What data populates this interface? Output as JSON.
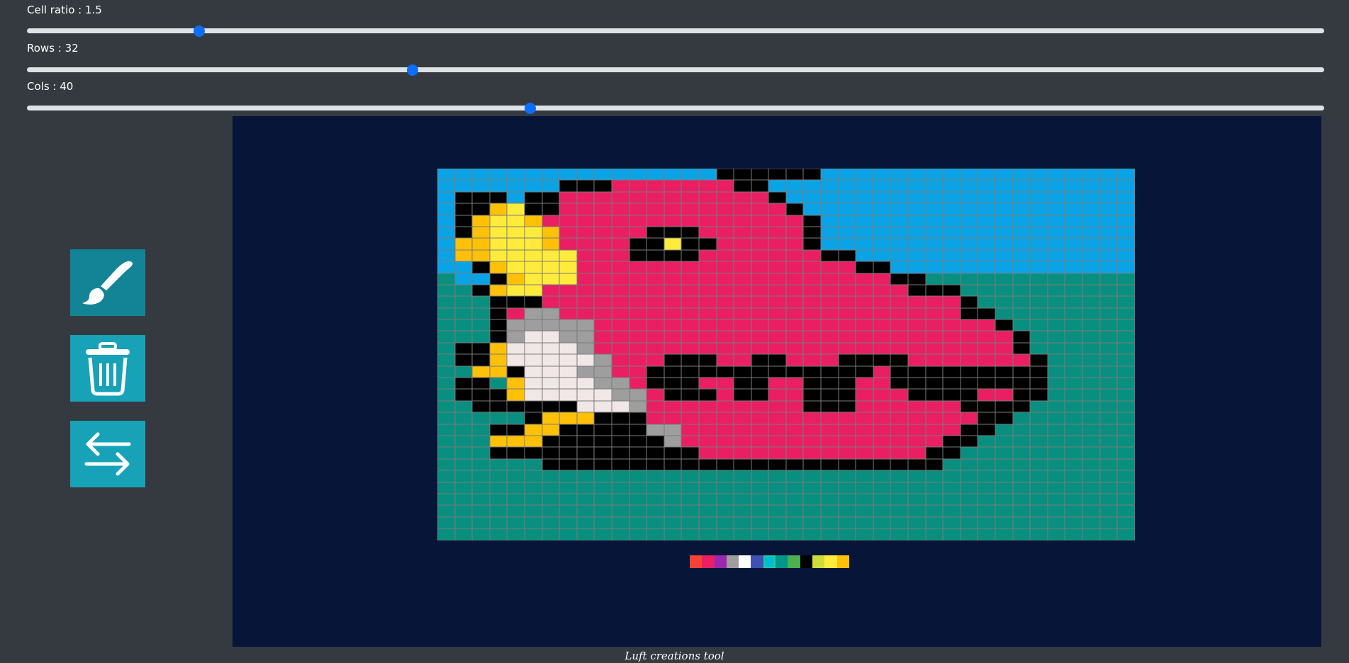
{
  "controls": {
    "cell_ratio": {
      "label": "Cell ratio : 1.5",
      "fraction": 0.133
    },
    "rows": {
      "label": "Rows : 32",
      "fraction": 0.297
    },
    "cols": {
      "label": "Cols : 40",
      "fraction": 0.388
    }
  },
  "toolbar": {
    "brush_icon": "paintbrush-icon",
    "clear_icon": "trash-icon",
    "swap_icon": "swap-arrows-icon"
  },
  "colors": {
    "0": "#0aa4e6",
    "1": "#088f7f",
    "2": "#000000",
    "3": "#e91e63",
    "4": "#ffc107",
    "5": "#ffeb3b",
    "6": "#9e9e9e",
    "7": "#f1e7e7"
  },
  "grid": {
    "rows": [
      "0000000000000000222222000000000000000000",
      "0000000222333333322000000000000000000000",
      "0222022333333333333200000000000000000000",
      "0224522333333333333320000000000000000000",
      "0245543333333333333332000000000000000000",
      "0245554333332223333332000000000000000000",
      "0445554333322522333332000000000000000000",
      "0445555533322223333333220000000000000000",
      "0024555533333333333333332200000000000000",
      "1002455533333333333333333322111111111111",
      "1124553333333333333333333332221111111111",
      "1112223333333333333333333333332111111111",
      "1112366333333333333333333333332211111111",
      "1112666663333333333333333333333321111111",
      "1112677663333333333333333333333332111111",
      "1224777763333333333333333333333332111111",
      "1224777776333222332233322223333333211111",
      "1144277766332222222222222322222222211111",
      "1221477776632223322332223322222222211111",
      "1222477777663222322332223332222332211111",
      "1122222277763333333332223333332222111111",
      "1111124442223333333333333333333221111111",
      "1112244222226633333333333333332211111111",
      "1114442222222633333333333333322111111111",
      "1112222222222223333333333333221111111111",
      "1111112222222222222222222222211111111111",
      "1111111111111111111111111111111111111111",
      "1111111111111111111111111111111111111111",
      "1111111111111111111111111111111111111111",
      "1111111111111111111111111111111111111111",
      "1111111111111111111111111111111111111111",
      "1111111111111111111111111111111111111111"
    ]
  },
  "palette": {
    "swatches": [
      "#f44336",
      "#e91e63",
      "#9c27b0",
      "#9e9e9e",
      "#ffffff",
      "#3f51b5",
      "#00bcd4",
      "#009688",
      "#4caf50",
      "#000000",
      "#cddc39",
      "#ffeb3b",
      "#ffc107"
    ],
    "selected_index": 6
  },
  "footer": {
    "text": "Luft creations tool"
  }
}
